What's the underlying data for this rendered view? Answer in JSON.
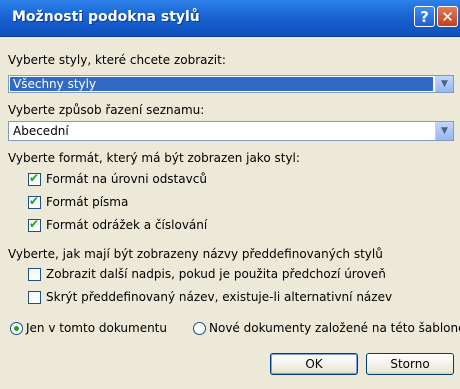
{
  "window": {
    "title": "Možnosti podokna stylů",
    "help_glyph": "?",
    "close_glyph": "✕"
  },
  "show_styles": {
    "label": "Vyberte styly, které chcete zobrazit:",
    "selected_value": "Všechny styly"
  },
  "sort_order": {
    "label": "Vyberte způsob řazení seznamu:",
    "selected_value": "Abecední"
  },
  "format_section": {
    "label": "Vyberte formát, který má být zobrazen jako styl:",
    "options": [
      {
        "label": "Formát na úrovni odstavců",
        "checked": true
      },
      {
        "label": "Formát písma",
        "checked": true
      },
      {
        "label": "Formát odrážek a číslování",
        "checked": true
      }
    ]
  },
  "builtin_section": {
    "label": "Vyberte, jak mají být zobrazeny názvy předdefinovaných stylů",
    "options": [
      {
        "label": "Zobrazit další nadpis, pokud je použita předchozí úroveň",
        "checked": false
      },
      {
        "label": "Skrýt předdefinovaný název, existuje-li alternativní název",
        "checked": false
      }
    ]
  },
  "scope": {
    "options": [
      {
        "label": "Jen v tomto dokumentu",
        "selected": true
      },
      {
        "label": "Nové dokumenty založené na této šabloně",
        "selected": false
      }
    ]
  },
  "buttons": {
    "ok": "OK",
    "cancel": "Storno"
  }
}
